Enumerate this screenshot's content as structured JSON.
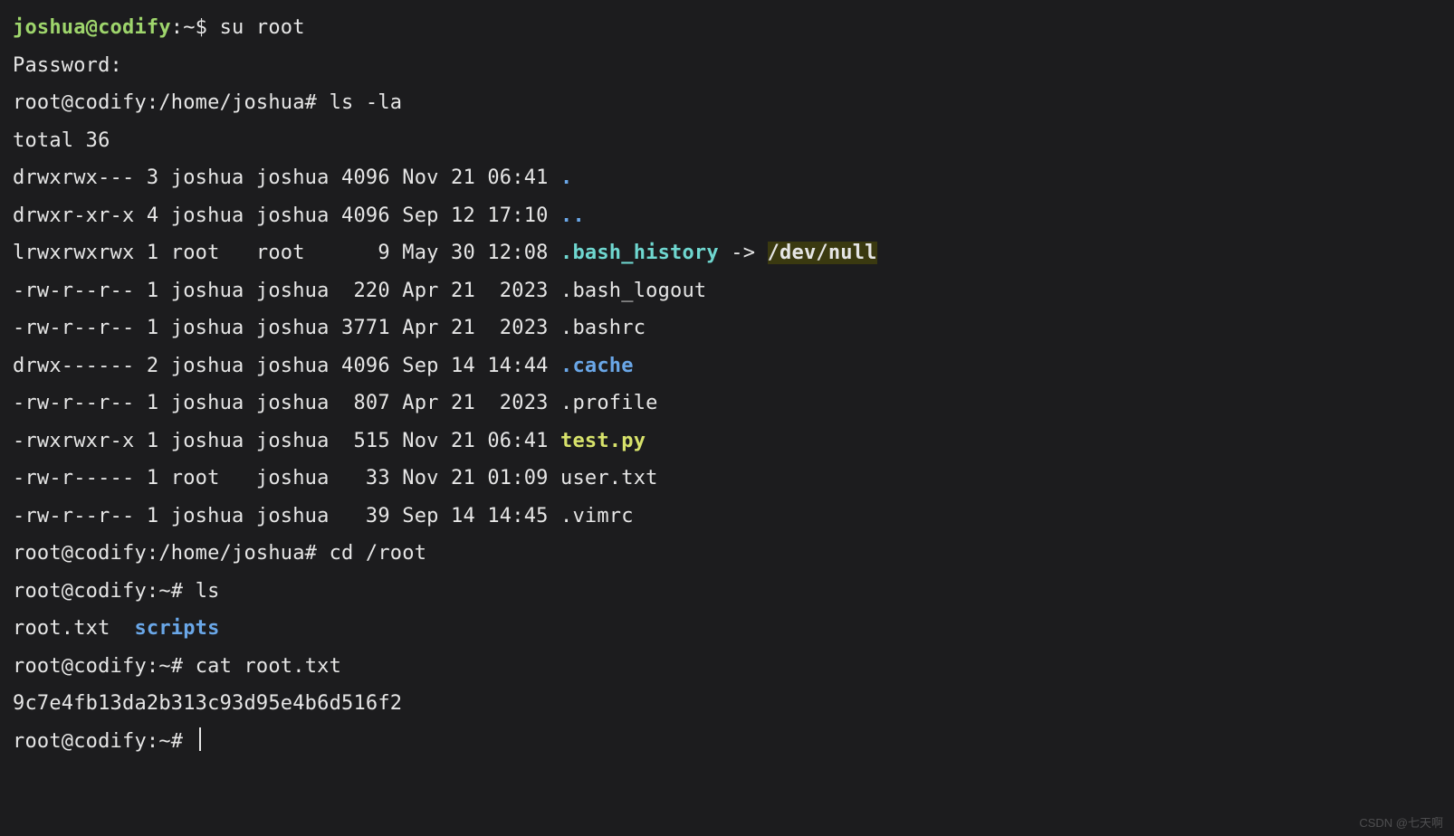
{
  "lines": [
    {
      "segments": [
        {
          "cls": "prompt-user",
          "bind": "t.p1_user"
        },
        {
          "cls": "",
          "bind": "t.p1_rest"
        }
      ]
    },
    {
      "segments": [
        {
          "cls": "",
          "bind": "t.pwd_prompt"
        }
      ]
    },
    {
      "segments": [
        {
          "cls": "prompt-root",
          "bind": "t.p2_prompt"
        },
        {
          "cls": "",
          "bind": "t.p2_cmd"
        }
      ]
    },
    {
      "segments": [
        {
          "cls": "",
          "bind": "t.total"
        }
      ]
    },
    {
      "segments": [
        {
          "cls": "",
          "bind": "t.r0_a"
        },
        {
          "cls": "dir",
          "bind": "t.r0_b"
        }
      ]
    },
    {
      "segments": [
        {
          "cls": "",
          "bind": "t.r1_a"
        },
        {
          "cls": "dir",
          "bind": "t.r1_b"
        }
      ]
    },
    {
      "segments": [
        {
          "cls": "",
          "bind": "t.r2_a"
        },
        {
          "cls": "symlink",
          "bind": "t.r2_b"
        },
        {
          "cls": "",
          "bind": "t.r2_c"
        },
        {
          "cls": "hl",
          "bind": "t.r2_d"
        }
      ]
    },
    {
      "segments": [
        {
          "cls": "",
          "bind": "t.r3"
        }
      ]
    },
    {
      "segments": [
        {
          "cls": "",
          "bind": "t.r4"
        }
      ]
    },
    {
      "segments": [
        {
          "cls": "",
          "bind": "t.r5_a"
        },
        {
          "cls": "dir",
          "bind": "t.r5_b"
        }
      ]
    },
    {
      "segments": [
        {
          "cls": "",
          "bind": "t.r6"
        }
      ]
    },
    {
      "segments": [
        {
          "cls": "",
          "bind": "t.r7_a"
        },
        {
          "cls": "exe",
          "bind": "t.r7_b"
        }
      ]
    },
    {
      "segments": [
        {
          "cls": "",
          "bind": "t.r8"
        }
      ]
    },
    {
      "segments": [
        {
          "cls": "",
          "bind": "t.r9"
        }
      ]
    },
    {
      "segments": [
        {
          "cls": "prompt-root",
          "bind": "t.p3_prompt"
        },
        {
          "cls": "",
          "bind": "t.p3_cmd"
        }
      ]
    },
    {
      "segments": [
        {
          "cls": "prompt-root",
          "bind": "t.p4_prompt"
        },
        {
          "cls": "",
          "bind": "t.p4_cmd"
        }
      ]
    },
    {
      "segments": [
        {
          "cls": "",
          "bind": "t.ls1_a"
        },
        {
          "cls": "dir",
          "bind": "t.ls1_b"
        }
      ]
    },
    {
      "segments": [
        {
          "cls": "prompt-root",
          "bind": "t.p5_prompt"
        },
        {
          "cls": "",
          "bind": "t.p5_cmd"
        }
      ]
    },
    {
      "segments": [
        {
          "cls": "",
          "bind": "t.flag"
        }
      ]
    },
    {
      "segments": [
        {
          "cls": "prompt-root",
          "bind": "t.p6_prompt"
        }
      ],
      "caret": true
    }
  ],
  "t": {
    "p1_user": "joshua@codify",
    "p1_rest": ":~$ su root",
    "pwd_prompt": "Password:",
    "p2_prompt": "root@codify:/home/joshua# ",
    "p2_cmd": "ls -la",
    "total": "total 36",
    "r0_a": "drwxrwx--- 3 joshua joshua 4096 Nov 21 06:41 ",
    "r0_b": ".",
    "r1_a": "drwxr-xr-x 4 joshua joshua 4096 Sep 12 17:10 ",
    "r1_b": "..",
    "r2_a": "lrwxrwxrwx 1 root   root      9 May 30 12:08 ",
    "r2_b": ".bash_history",
    "r2_c": " -> ",
    "r2_d": "/dev/null",
    "r3": "-rw-r--r-- 1 joshua joshua  220 Apr 21  2023 .bash_logout",
    "r4": "-rw-r--r-- 1 joshua joshua 3771 Apr 21  2023 .bashrc",
    "r5_a": "drwx------ 2 joshua joshua 4096 Sep 14 14:44 ",
    "r5_b": ".cache",
    "r6": "-rw-r--r-- 1 joshua joshua  807 Apr 21  2023 .profile",
    "r7_a": "-rwxrwxr-x 1 joshua joshua  515 Nov 21 06:41 ",
    "r7_b": "test.py",
    "r8": "-rw-r----- 1 root   joshua   33 Nov 21 01:09 user.txt",
    "r9": "-rw-r--r-- 1 joshua joshua   39 Sep 14 14:45 .vimrc",
    "p3_prompt": "root@codify:/home/joshua# ",
    "p3_cmd": "cd /root",
    "p4_prompt": "root@codify:~# ",
    "p4_cmd": "ls",
    "ls1_a": "root.txt  ",
    "ls1_b": "scripts",
    "p5_prompt": "root@codify:~# ",
    "p5_cmd": "cat root.txt",
    "flag": "9c7e4fb13da2b313c93d95e4b6d516f2",
    "p6_prompt": "root@codify:~# "
  },
  "watermark": "CSDN @七天啊"
}
